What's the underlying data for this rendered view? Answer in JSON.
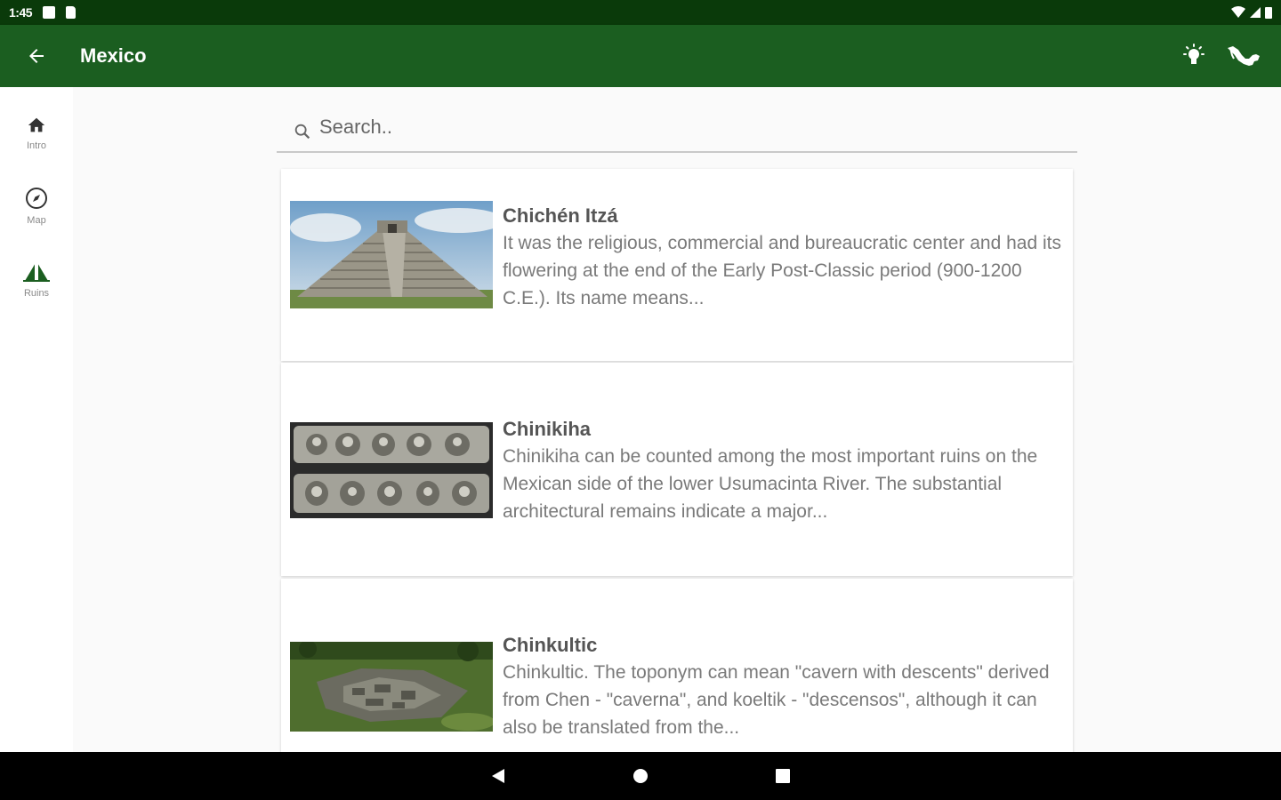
{
  "status_bar": {
    "time": "1:45",
    "icons": [
      "notification-icon",
      "sd-card-icon",
      "wifi-icon",
      "signal-icon",
      "battery-icon"
    ]
  },
  "app_bar": {
    "title": "Mexico",
    "back_icon": "arrow-back-icon",
    "actions": [
      "lightbulb-icon",
      "mexico-map-icon"
    ],
    "color": "#1b5e20"
  },
  "rail": {
    "items": [
      {
        "label": "Intro",
        "icon": "home-icon"
      },
      {
        "label": "Map",
        "icon": "compass-icon"
      },
      {
        "label": "Ruins",
        "icon": "pyramid-icon",
        "active": true
      }
    ]
  },
  "search": {
    "placeholder": "Search..",
    "value": ""
  },
  "results": [
    {
      "name": "Chichén Itzá",
      "description": "It was the religious, commercial and bureaucratic center and had its flowering at the end of the Early Post-Classic period (900-1200 C.E.). Its name means..."
    },
    {
      "name": "Chinikiha",
      "description": "Chinikiha can be counted among the most important ruins on the Mexican side of the lower Usumacinta River. The substantial architectural remains indicate a major..."
    },
    {
      "name": "Chinkultic",
      "description": "Chinkultic. The toponym can mean \"cavern with descents\" derived from Chen - \"caverna\", and koeltik - \"descensos\", although it can also be translated from the..."
    }
  ],
  "nav_bar": [
    "back-triangle-icon",
    "home-circle-icon",
    "recents-square-icon"
  ]
}
